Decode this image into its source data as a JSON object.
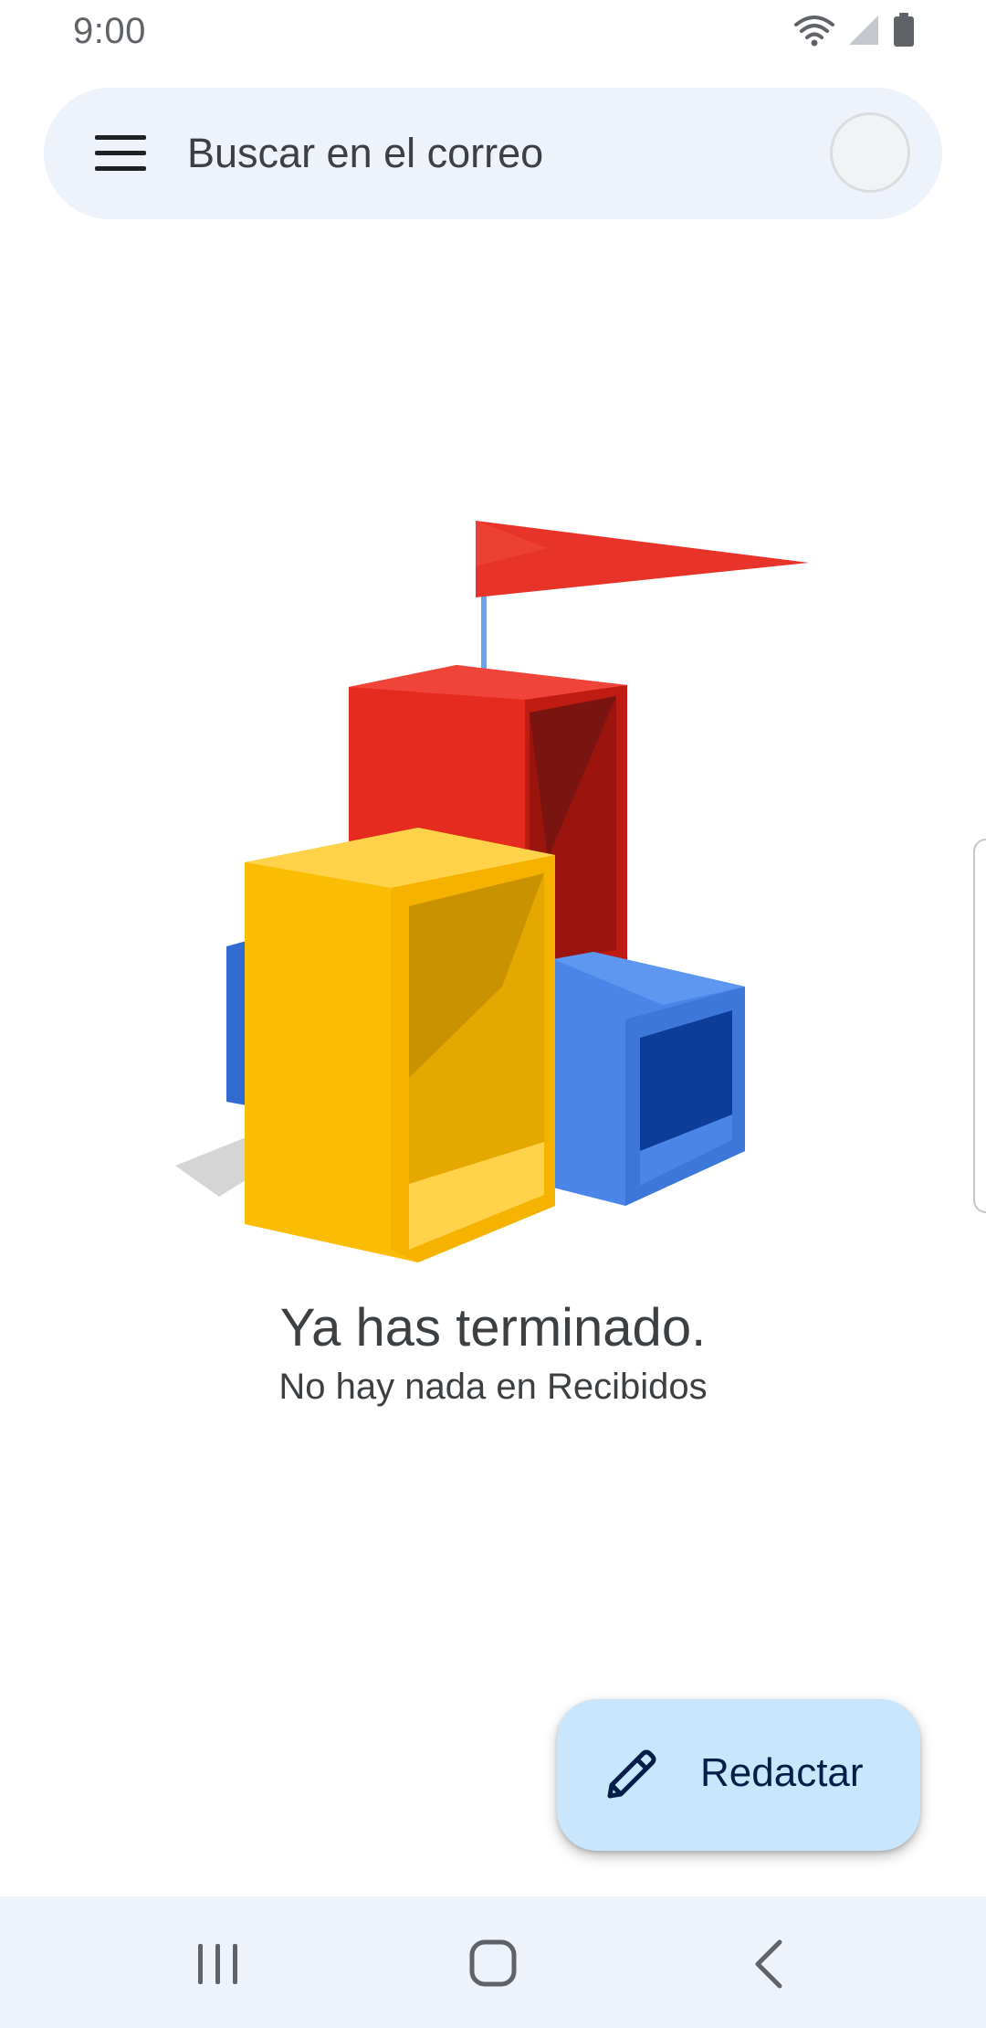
{
  "status_bar": {
    "time": "9:00",
    "icons": [
      "wifi-icon",
      "signal-icon",
      "battery-icon"
    ]
  },
  "search": {
    "placeholder": "Buscar en el correo",
    "menu_icon": "menu-icon",
    "avatar": "avatar"
  },
  "empty_state": {
    "title": "Ya has terminado.",
    "subtitle": "No hay nada en Recibidos",
    "illustration": "building-blocks-with-flag",
    "colors": {
      "red": "#d93025",
      "yellow": "#fbbc04",
      "blue": "#4285f4"
    }
  },
  "compose": {
    "label": "Redactar",
    "icon": "pencil-icon",
    "background": "#c9e6fd"
  },
  "nav_bar": {
    "buttons": [
      "recent-apps-icon",
      "home-icon",
      "back-icon"
    ]
  }
}
